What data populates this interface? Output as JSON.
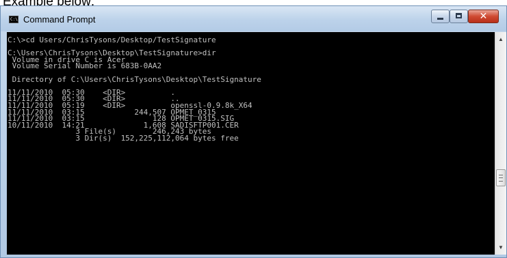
{
  "caption": "Example below:",
  "window": {
    "title": "Command Prompt",
    "icon": "console-app-icon",
    "icon_text": "C:\\",
    "controls": {
      "minimize": "minimize-icon",
      "maximize": "maximize-icon",
      "close": "close-icon",
      "close_glyph": "✕"
    }
  },
  "console_text": "C:\\>cd Users/ChrisTysons/Desktop/TestSignature\n\nC:\\Users\\ChrisTysons\\Desktop\\TestSignature>dir\n Volume in drive C is Acer\n Volume Serial Number is 683B-0AA2\n\n Directory of C:\\Users\\ChrisTysons\\Desktop\\TestSignature\n\n11/11/2010  05:30    <DIR>          .\n11/11/2010  05:30    <DIR>          ..\n11/11/2010  05:19    <DIR>          openssl-0.9.8k_X64\n11/11/2010  03:15           244,507 OPMET_0315\n11/11/2010  03:15               128 OPMET_0315.SIG\n10/11/2010  14:21             1,608 SADISFTP001.CER\n               3 File(s)        246,243 bytes\n               3 Dir(s)  152,225,112,064 bytes free",
  "scrollbar": {
    "up_glyph": "▲",
    "down_glyph": "▼"
  }
}
